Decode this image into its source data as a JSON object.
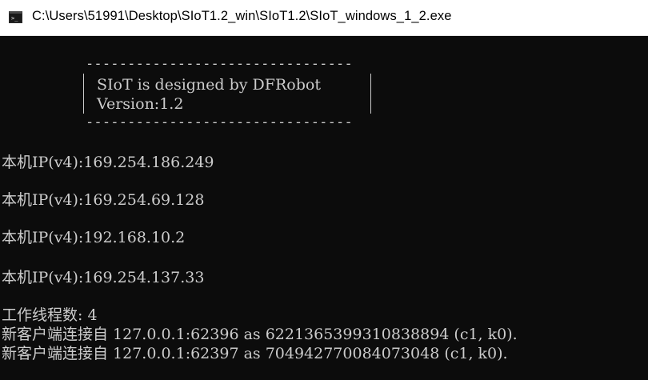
{
  "window": {
    "title": "C:\\Users\\51991\\Desktop\\SIoT1.2_win\\SIoT1.2\\SIoT_windows_1_2.exe",
    "icon": "console-icon"
  },
  "banner": {
    "top_rule": "--------------------------------",
    "bottom_rule": "--------------------------------",
    "line1": "SIoT is designed by DFRobot",
    "line2": "Version:1.2"
  },
  "output": {
    "ip_lines": [
      "本机IP(v4):169.254.186.249",
      "本机IP(v4):169.254.69.128",
      "本机IP(v4):192.168.10.2",
      "本机IP(v4):169.254.137.33"
    ],
    "workers": "工作线程数: 4",
    "clients": [
      "新客户端连接自 127.0.0.1:62396 as 6221365399310838894 (c1, k0).",
      "新客户端连接自 127.0.0.1:62397 as 704942770084073048 (c1, k0)."
    ]
  },
  "colors": {
    "console_bg": "#0c0c0c",
    "console_fg": "#cccccc",
    "titlebar_bg": "#ffffff"
  }
}
